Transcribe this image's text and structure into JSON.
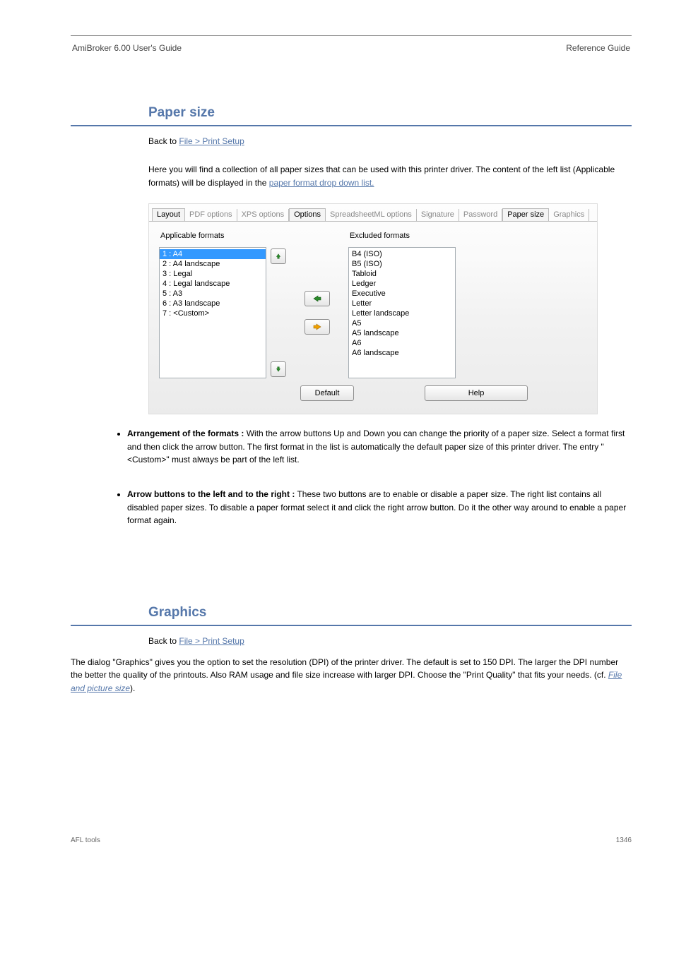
{
  "header": {
    "left": "AmiBroker 6.00 User's Guide",
    "right": "Reference Guide"
  },
  "section": {
    "name": "Paper size",
    "back_to_label": "Back to",
    "back_to_link": "File > Print Setup"
  },
  "intro": "Here you will find a collection of all paper sizes that can be used with this printer driver. The content of the left list (Applicable formats) will be displayed in the",
  "intro_link": "paper format drop down list.",
  "tabs": [
    {
      "label": "Layout",
      "active": true
    },
    {
      "label": "PDF options",
      "active": false
    },
    {
      "label": "XPS options",
      "active": false
    },
    {
      "label": "Options",
      "active": true
    },
    {
      "label": "SpreadsheetML options",
      "active": false
    },
    {
      "label": "Signature",
      "active": false
    },
    {
      "label": "Password",
      "active": false
    },
    {
      "label": "Paper size",
      "active": true
    },
    {
      "label": "Graphics",
      "active": false
    }
  ],
  "lists": {
    "applicable_label": "Applicable formats",
    "excluded_label": "Excluded formats",
    "applicable": [
      {
        "text": "1 : A4",
        "selected": true
      },
      {
        "text": "2 : A4 landscape"
      },
      {
        "text": "3 : Legal"
      },
      {
        "text": "4 : Legal landscape"
      },
      {
        "text": "5 : A3"
      },
      {
        "text": "6 : A3 landscape"
      },
      {
        "text": "7 : <Custom>"
      }
    ],
    "excluded": [
      {
        "text": "B4 (ISO)"
      },
      {
        "text": "B5 (ISO)"
      },
      {
        "text": "Tabloid"
      },
      {
        "text": "Ledger"
      },
      {
        "text": "Executive"
      },
      {
        "text": "Letter"
      },
      {
        "text": "Letter landscape"
      },
      {
        "text": "A5"
      },
      {
        "text": "A5 landscape"
      },
      {
        "text": "A6"
      },
      {
        "text": "A6 landscape"
      }
    ]
  },
  "buttons": {
    "default": "Default",
    "help": "Help"
  },
  "bullets": [
    {
      "head": "Arrangement of the formats",
      "body": "With the arrow buttons Up and Down you can change the priority of a paper size. Select a format first and then click the arrow button. The first format in the list is automatically the default paper size of this printer driver. The entry \"<Custom>\" must always be part of the left list."
    },
    {
      "head": "Arrow buttons to the left and to the right",
      "body": "These two buttons are to enable or disable a paper size. The right list contains all disabled paper sizes. To disable a paper format select it and click the right arrow button. Do it the other way around to enable a paper format again."
    }
  ],
  "graphics": {
    "title": "Graphics",
    "back_to_label": "Back to",
    "back_to_link": "File > Print Setup",
    "body_plain": "The dialog \"Graphics\" gives you the option to set the resolution (DPI) of the printer driver. The default is set to 150 DPI. The larger the DPI number the better the quality of the printouts. Also RAM usage and file size increase with larger DPI. Choose the \"Print Quality\" that fits your needs. (cf.",
    "body_link": "File and picture size",
    "body_tail": ")."
  },
  "footer": {
    "left": "AFL tools",
    "right": "1346"
  }
}
